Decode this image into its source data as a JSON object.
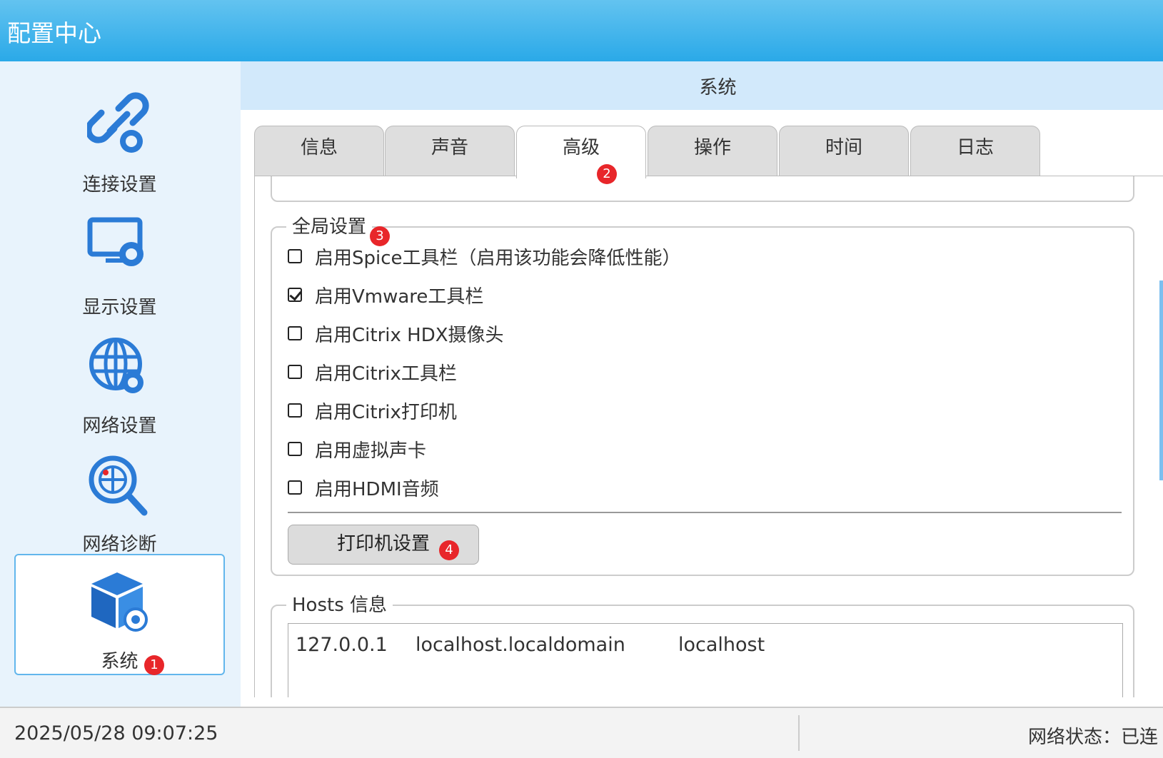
{
  "window": {
    "title": "配置中心"
  },
  "sidebar": {
    "items": [
      {
        "label": "连接设置",
        "icon": "link-gear-icon"
      },
      {
        "label": "显示设置",
        "icon": "monitor-gear-icon"
      },
      {
        "label": "网络设置",
        "icon": "globe-gear-icon"
      },
      {
        "label": "网络诊断",
        "icon": "globe-magnifier-icon"
      },
      {
        "label": "系统",
        "icon": "cube-gear-icon",
        "active": true
      }
    ]
  },
  "content": {
    "header": "系统",
    "tabs": [
      {
        "label": "信息"
      },
      {
        "label": "声音"
      },
      {
        "label": "高级",
        "active": true
      },
      {
        "label": "操作"
      },
      {
        "label": "时间"
      },
      {
        "label": "日志"
      }
    ],
    "global_settings": {
      "legend": "全局设置",
      "options": [
        {
          "label": "启用Spice工具栏（启用该功能会降低性能）",
          "checked": false
        },
        {
          "label": "启用Vmware工具栏",
          "checked": true
        },
        {
          "label": "启用Citrix HDX摄像头",
          "checked": false
        },
        {
          "label": "启用Citrix工具栏",
          "checked": false
        },
        {
          "label": "启用Citrix打印机",
          "checked": false
        },
        {
          "label": "启用虚拟声卡",
          "checked": false
        },
        {
          "label": "启用HDMI音频",
          "checked": false
        }
      ],
      "printer_button": "打印机设置"
    },
    "hosts": {
      "legend": "Hosts 信息",
      "entries": [
        {
          "ip": "127.0.0.1",
          "fqdn": "localhost.localdomain",
          "alias": "localhost"
        }
      ]
    }
  },
  "badges": [
    "1",
    "2",
    "3",
    "4"
  ],
  "status": {
    "datetime": "2025/05/28 09:07:25",
    "network": "网络状态：已连"
  },
  "colors": {
    "titlebar": "#2aa9e8",
    "accent": "#62b6ec",
    "badge": "#e8262a"
  }
}
